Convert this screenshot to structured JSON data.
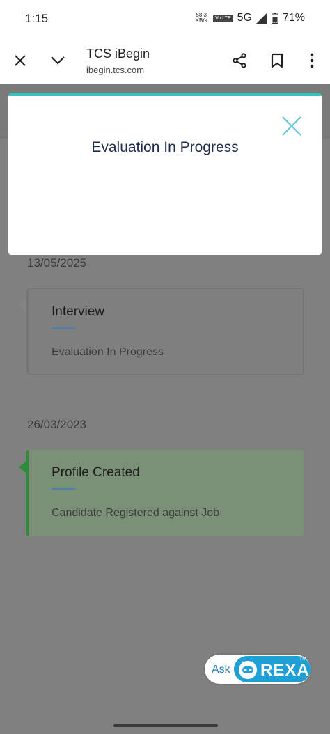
{
  "status_bar": {
    "time": "1:15",
    "net_speed_value": "58.3",
    "net_speed_unit": "KB/s",
    "volte": "Vo LTE",
    "network": "5G",
    "battery": "71%"
  },
  "browser": {
    "title": "TCS iBegin",
    "url": "ibegin.tcs.com"
  },
  "modal": {
    "title": "Evaluation In Progress"
  },
  "timeline": [
    {
      "date": "13/05/2025",
      "title": "Interview",
      "subtitle": "Evaluation In Progress",
      "status": "pending"
    },
    {
      "date": "26/03/2023",
      "title": "Profile Created",
      "subtitle": "Candidate Registered against Job",
      "status": "completed"
    }
  ],
  "rexa": {
    "ask": "Ask",
    "brand": "REXA",
    "tm": "TM"
  },
  "colors": {
    "accent": "#35c3c9",
    "completed": "#2f8a3a",
    "modal_title": "#1f2d4d",
    "rexa_blue": "#1e9fd6"
  }
}
